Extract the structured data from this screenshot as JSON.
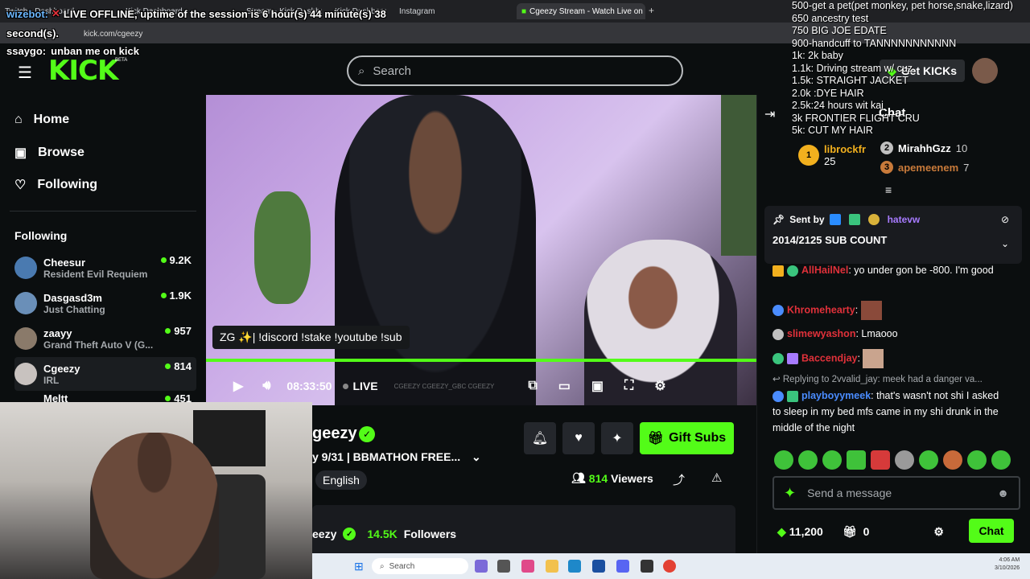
{
  "browser": {
    "tabs": [
      {
        "label": "Twitch - Dashboard"
      },
      {
        "label": "Kick Dashboard"
      },
      {
        "label": "Stream - Kick Dashboard"
      },
      {
        "label": "Kick Dashboard"
      },
      {
        "label": "Instagram"
      },
      {
        "label": "Cgeezy Stream - Watch Live on"
      }
    ],
    "url": "kick.com/cgeezy"
  },
  "overlay": {
    "bot_name": "wizebot:",
    "offline_line": "LIVE OFFLINE, uptime of the session is 6 hour(s) 44 minute(s) 38",
    "offline_line2": "second(s).",
    "chat_user": "ssaygo:",
    "chat_text": "unban me on kick",
    "goals": [
      "500-get a pet(pet monkey, pet horse,snake,lizard)",
      "650 ancestry test",
      "750 BIG JOE EDATE",
      "900-handcuff to TANNNNNNNNNNN",
      "1k: 2k baby",
      "1.1k: Driving stream w/ cuz",
      "1.5k: STRAIGHT JACKET",
      "2.0k :DYE HAIR",
      "2.5k:24 hours wit kai",
      "3k FRONTIER FLIGHT CRU",
      "5k: CUT MY HAIR"
    ]
  },
  "header": {
    "logo": "KICK",
    "beta": "BETA",
    "search_placeholder": "Search",
    "get_kicks": "Get KICKs"
  },
  "sidebar": {
    "nav": [
      {
        "label": "Home"
      },
      {
        "label": "Browse"
      },
      {
        "label": "Following"
      }
    ],
    "following_title": "Following",
    "channels": [
      {
        "name": "Cheesur",
        "category": "Resident Evil Requiem",
        "viewers": "9.2K"
      },
      {
        "name": "Dasgasd3m",
        "category": "Just Chatting",
        "viewers": "1.9K"
      },
      {
        "name": "zaayy",
        "category": "Grand Theft Auto V (G...",
        "viewers": "957"
      },
      {
        "name": "Cgeezy",
        "category": "IRL",
        "viewers": "814"
      },
      {
        "name": "Meltt",
        "category": "",
        "viewers": "451"
      }
    ]
  },
  "player": {
    "chat_command": "ZG ✨| !discord !stake !youtube !sub",
    "time": "08:33:50",
    "live": "LIVE",
    "watermark": "CGEEZY  CGEEZY_GBC  CGEEZY",
    "progress": 1.0
  },
  "stream": {
    "streamer": "geezy",
    "title": "y 9/31 | BBMATHON FREE...",
    "language": "English",
    "viewers_count": "814",
    "viewers_label": "Viewers",
    "gift_label": "Gift Subs",
    "follower_name": "eezy",
    "followers_count": "14.5K",
    "followers_label": "Followers"
  },
  "chat": {
    "title": "Chat",
    "leaderboard": [
      {
        "rank": "1",
        "name": "librockfr",
        "count": "25"
      },
      {
        "rank": "2",
        "name": "MirahhGzz",
        "count": "10"
      },
      {
        "rank": "3",
        "name": "apemeenem",
        "count": "7"
      }
    ],
    "pinned": {
      "sent_by": "Sent by",
      "user": "hatevw",
      "message": "2014/2125 SUB COUNT"
    },
    "messages": [
      {
        "user": "AllHailNel",
        "text": ": yo under gon be -800. I'm good",
        "color": "#e0313a"
      },
      {
        "user": "Khromehearty",
        "text": ":",
        "color": "#e0313a"
      },
      {
        "user": "slimewyashon",
        "text": ": Lmaooo",
        "color": "#e0313a"
      },
      {
        "user": "Baccendjay",
        "text": ":",
        "color": "#e0313a"
      }
    ],
    "reply": {
      "replying": "Replying to 2vvalid_jay: meek had a danger va...",
      "user": "playboyymeek",
      "text": ": that's wasn't not shi I asked to sleep in my bed mfs came in my shi drunk in the middle of the night",
      "color": "#4a8cff"
    },
    "input_placeholder": "Send a message",
    "kicks_balance": "11,200",
    "gift_count": "0",
    "send_label": "Chat"
  },
  "taskbar": {
    "search": "Search",
    "time": "4:06 AM",
    "date": "3/10/2026"
  },
  "colors": {
    "accent": "#53fc18",
    "bg": "#0b0e0f"
  }
}
